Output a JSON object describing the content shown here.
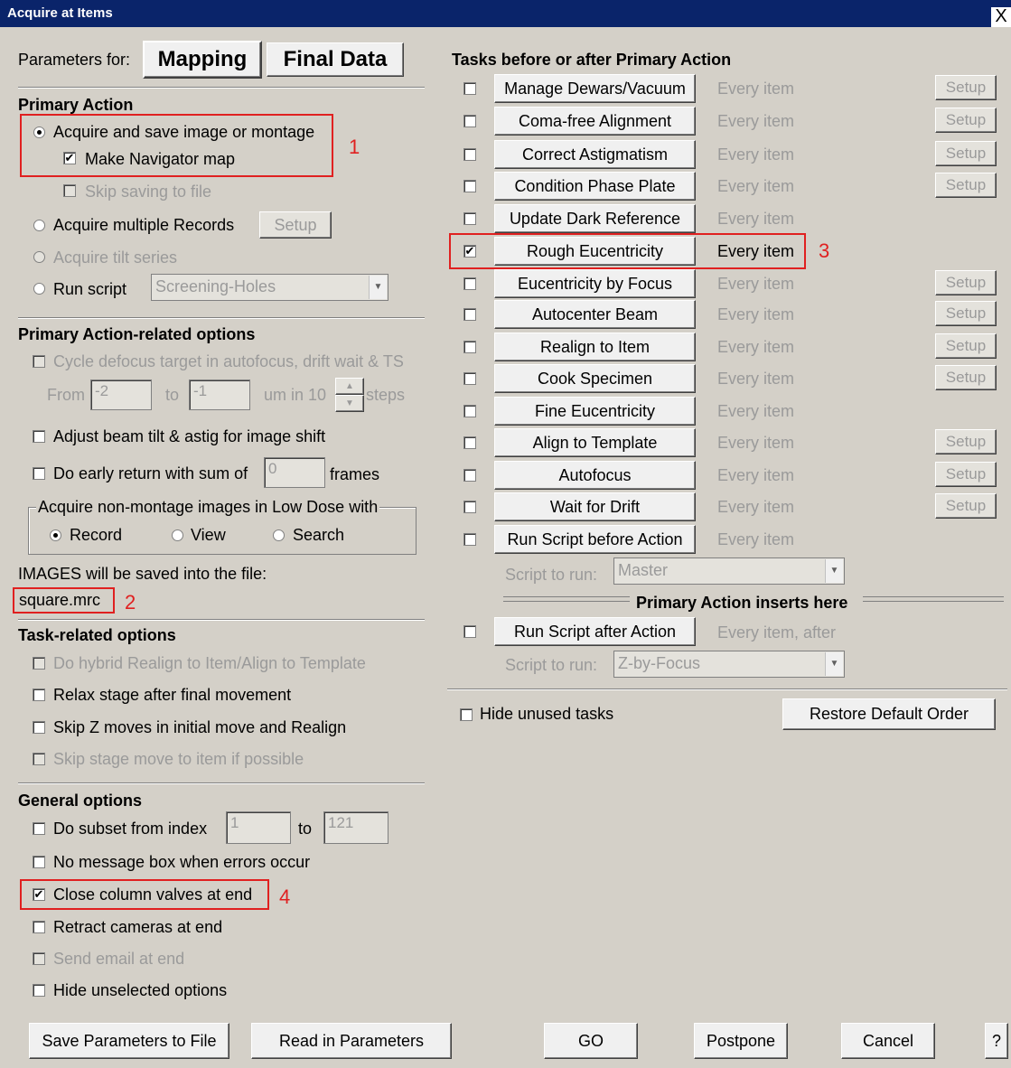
{
  "window": {
    "title": "Acquire at Items",
    "close_glyph": "X"
  },
  "params": {
    "label": "Parameters for:",
    "mapping": "Mapping",
    "final_data": "Final Data"
  },
  "primary": {
    "heading": "Primary Action",
    "acquire_save": "Acquire and save image or montage",
    "make_nav_map": "Make Navigator map",
    "skip_saving": "Skip saving to file",
    "acquire_multiple": "Acquire multiple Records",
    "setup": "Setup",
    "acquire_tilt": "Acquire tilt series",
    "run_script": "Run script",
    "run_script_value": "Screening-Holes"
  },
  "pa_options": {
    "heading": "Primary Action-related options",
    "cycle_defocus": "Cycle defocus target in autofocus, drift wait & TS",
    "from": "From",
    "from_value": "-2",
    "to": "to",
    "to_value": "-1",
    "um_in": "um in 10",
    "steps": "steps",
    "adjust_beam": "Adjust beam tilt & astig for image shift",
    "early_return": "Do early return with sum of",
    "early_value": "0",
    "frames": "frames",
    "low_dose_group": "Acquire non-montage images in Low Dose with",
    "record": "Record",
    "view": "View",
    "search": "Search",
    "images_saved": "IMAGES will be saved into the file:",
    "filename": "square.mrc"
  },
  "task_options": {
    "heading": "Task-related options",
    "hybrid": "Do hybrid Realign to Item/Align to Template",
    "relax": "Relax stage after final movement",
    "skip_z": "Skip Z moves in initial move and Realign",
    "skip_stage": "Skip stage move to item if possible"
  },
  "general": {
    "heading": "General options",
    "subset": "Do subset from index",
    "subset_from": "1",
    "to": "to",
    "subset_to": "121",
    "no_msg": "No message box when errors occur",
    "close_valves": "Close column valves at end",
    "retract": "Retract cameras at end",
    "email": "Send email at end",
    "hide_unselected": "Hide unselected options"
  },
  "tasks": {
    "heading": "Tasks before or after Primary Action",
    "items": [
      {
        "label": "Manage Dewars/Vacuum",
        "freq": "Every item",
        "checked": false,
        "setup": "Setup"
      },
      {
        "label": "Coma-free Alignment",
        "freq": "Every item",
        "checked": false,
        "setup": "Setup"
      },
      {
        "label": "Correct Astigmatism",
        "freq": "Every item",
        "checked": false,
        "setup": "Setup"
      },
      {
        "label": "Condition Phase Plate",
        "freq": "Every item",
        "checked": false,
        "setup": "Setup"
      },
      {
        "label": "Update Dark Reference",
        "freq": "Every item",
        "checked": false,
        "setup": ""
      },
      {
        "label": "Rough Eucentricity",
        "freq": "Every item",
        "checked": true,
        "setup": ""
      },
      {
        "label": "Eucentricity by Focus",
        "freq": "Every item",
        "checked": false,
        "setup": "Setup"
      },
      {
        "label": "Autocenter Beam",
        "freq": "Every item",
        "checked": false,
        "setup": "Setup"
      },
      {
        "label": "Realign to Item",
        "freq": "Every item",
        "checked": false,
        "setup": "Setup"
      },
      {
        "label": "Cook Specimen",
        "freq": "Every item",
        "checked": false,
        "setup": "Setup"
      },
      {
        "label": "Fine Eucentricity",
        "freq": "Every item",
        "checked": false,
        "setup": ""
      },
      {
        "label": "Align to Template",
        "freq": "Every item",
        "checked": false,
        "setup": "Setup"
      },
      {
        "label": "Autofocus",
        "freq": "Every item",
        "checked": false,
        "setup": "Setup"
      },
      {
        "label": "Wait for Drift",
        "freq": "Every item",
        "checked": false,
        "setup": "Setup"
      },
      {
        "label": "Run Script before Action",
        "freq": "Every item",
        "checked": false,
        "setup": ""
      }
    ],
    "script_to_run": "Script to run:",
    "script_before_value": "Master",
    "inserts_here": "Primary Action inserts here",
    "run_after": "Run Script after Action",
    "run_after_freq": "Every item, after",
    "script_after_value": "Z-by-Focus",
    "hide_unused": "Hide unused tasks",
    "restore_default": "Restore Default Order"
  },
  "annotations": {
    "n1": "1",
    "n2": "2",
    "n3": "3",
    "n4": "4"
  },
  "footer": {
    "save_params": "Save Parameters to File",
    "read_params": "Read in Parameters",
    "go": "GO",
    "postpone": "Postpone",
    "cancel": "Cancel",
    "help": "?"
  },
  "colors": {
    "titlebar": "#0a246a",
    "dialog_bg": "#d4d0c8",
    "annotation_red": "#e02020"
  }
}
